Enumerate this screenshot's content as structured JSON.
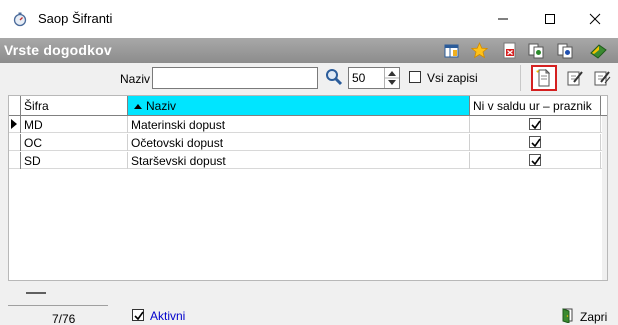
{
  "window": {
    "title": "Saop Šifranti",
    "app_icon": "stopwatch-icon",
    "controls": [
      "minimize-icon",
      "maximize-icon",
      "close-icon"
    ]
  },
  "module": {
    "title": "Vrste dogodkov",
    "toolbar_icons": [
      "column-chooser-icon",
      "favorite-star-icon",
      "export-pdf-icon",
      "copy-records-icon",
      "print-records-icon",
      "exit-book-icon"
    ]
  },
  "filter": {
    "naziv_label": "Naziv",
    "naziv_value": "",
    "search_icon": "magnifier-icon",
    "limit_value": "50",
    "vsi_zapisi_label": "Vsi zapisi",
    "vsi_zapisi_checked": false,
    "actions": [
      "new-record-icon",
      "edit-record-icon",
      "edit-multiple-icon"
    ]
  },
  "grid": {
    "columns": [
      "Šifra",
      "Naziv",
      "Ni v saldu ur – praznik"
    ],
    "sorted_column": "Naziv",
    "sorted_color": "#00e5ff",
    "rows": [
      {
        "sifra": "MD",
        "naziv": "Materinski dopust",
        "ni_v_saldu": true,
        "current": true
      },
      {
        "sifra": "OC",
        "naziv": "Očetovski dopust",
        "ni_v_saldu": true,
        "current": false
      },
      {
        "sifra": "SD",
        "naziv": "Starševski dopust",
        "ni_v_saldu": true,
        "current": false
      }
    ]
  },
  "footer": {
    "record_count": "7/76",
    "aktivni_label": "Aktivni",
    "aktivni_checked": true,
    "close_label": "Zapri"
  }
}
